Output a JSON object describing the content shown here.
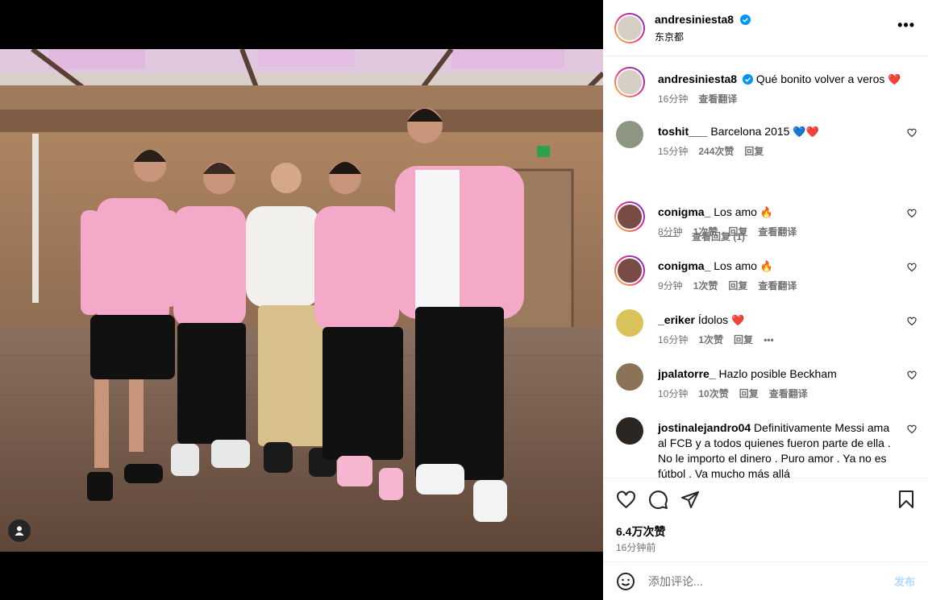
{
  "post": {
    "username": "andresiniesta8",
    "location": "东京都",
    "caption_user": "andresiniesta8",
    "caption_text": "Qué bonito volver a veros",
    "caption_time": "16分钟",
    "caption_translate": "查看翻译",
    "likes": "6.4万次赞",
    "time_ago": "16分钟前",
    "add_comment_placeholder": "添加评论...",
    "post_button": "发布"
  },
  "comments": [
    {
      "user": "toshit___",
      "text": "Barcelona 2015",
      "emoji": "💙❤️",
      "time": "15分钟",
      "likes": "244次赞",
      "reply": "回复",
      "translate": ""
    },
    {
      "user": "conigma_",
      "text": "Los amo",
      "emoji": "🔥",
      "time": "8分钟",
      "likes": "1次赞",
      "reply": "回复",
      "translate": "查看翻译"
    },
    {
      "user": "conigma_",
      "text": "Los amo",
      "emoji": "🔥",
      "time": "9分钟",
      "likes": "1次赞",
      "reply": "回复",
      "translate": "查看翻译"
    },
    {
      "user": "_eriker",
      "text": "Ídolos",
      "emoji": "❤️",
      "time": "16分钟",
      "likes": "1次赞",
      "reply": "回复",
      "translate": "•••"
    },
    {
      "user": "jpalatorre_",
      "text": "Hazlo posible Beckham",
      "emoji": "",
      "time": "10分钟",
      "likes": "10次赞",
      "reply": "回复",
      "translate": "查看翻译"
    },
    {
      "user": "jostinalejandro04",
      "text": "Definitivamente Messi ama al FCB y a todos quienes fueron parte de ella . No le importo el dinero . Puro amor . Ya no es fútbol . Va mucho más allá",
      "emoji": "",
      "time": "",
      "likes": "",
      "reply": "",
      "translate": ""
    }
  ],
  "view_replies": "查看回复 (1)",
  "icons": {
    "more": "more-options-icon",
    "verified": "verified-badge-icon",
    "like": "heart-icon",
    "comment": "comment-icon",
    "share": "share-icon",
    "save": "bookmark-icon",
    "emoji": "emoji-icon",
    "tag": "user-tag-icon"
  },
  "colors": {
    "verified": "#0095f6",
    "ring_start": "#f9ce34",
    "ring_end": "#6228d7",
    "jersey_pink": "#f4a9c8",
    "post_button": "#b3dbff"
  }
}
